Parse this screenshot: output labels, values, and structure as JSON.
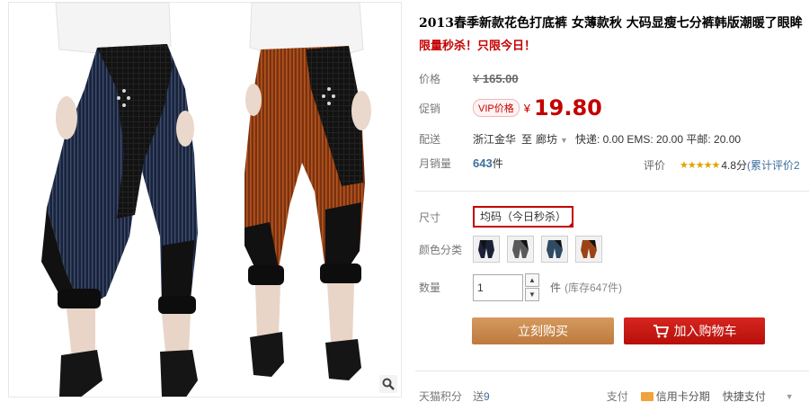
{
  "product": {
    "title": "2013春季新款花色打底裤 女薄款秋 大码显瘦七分裤韩版潮暖了眼眸",
    "promo_text": "限量秒杀！只限今日！"
  },
  "price": {
    "label": "价格",
    "currency": "¥",
    "original": "165.00",
    "promo_label": "促销",
    "vip_badge": "VIP价格",
    "promo_currency": "¥",
    "promo_value": "19.80"
  },
  "shipping": {
    "label": "配送",
    "from": "浙江金华",
    "to_word": "至",
    "destination": "廊坊",
    "fees": "快递: 0.00 EMS: 20.00 平邮: 20.00"
  },
  "sales": {
    "label": "月销量",
    "count": "643",
    "unit": "件",
    "rating_label": "评价",
    "stars": "★★★★★",
    "rating_value": "4.8分",
    "review_link": "(累计评价2"
  },
  "options": {
    "size_label": "尺寸",
    "size_selected": "均码（今日秒杀）",
    "color_label": "颜色分类",
    "colors": [
      "navy-pinstripe",
      "grey-pinstripe",
      "blue-pinstripe",
      "brown-pinstripe"
    ]
  },
  "quantity": {
    "label": "数量",
    "value": "1",
    "unit": "件",
    "stock": "(库存647件)",
    "up_glyph": "▲",
    "down_glyph": "▼"
  },
  "actions": {
    "buy_now": "立刻购买",
    "add_to_cart": "加入购物车"
  },
  "footer": {
    "points_label": "天猫积分",
    "points_text": "送",
    "points_value": "9",
    "pay_label": "支付",
    "pay_card": "信用卡分期",
    "pay_quick": "快捷支付"
  },
  "colors": {
    "accent_red": "#c40000",
    "buy_button": "#c98a4b",
    "cart_button": "#c7140f",
    "link_blue": "#3d6f9e"
  }
}
